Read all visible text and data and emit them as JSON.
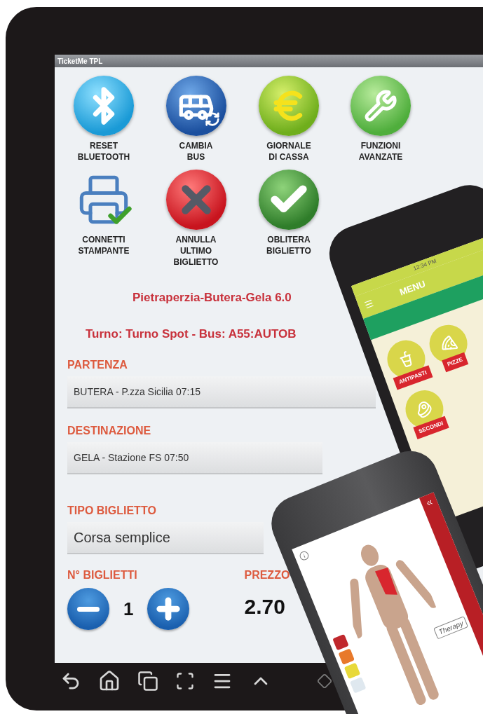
{
  "window": {
    "title": "TicketMe TPL"
  },
  "actions": [
    {
      "kind": "bluetooth",
      "label": "RESET\nBLUETOOTH"
    },
    {
      "kind": "bus",
      "label": "CAMBIA\nBUS"
    },
    {
      "kind": "cash",
      "label": "GIORNALE\nDI CASSA"
    },
    {
      "kind": "tools",
      "label": "FUNZIONI\nAVANZATE"
    },
    {
      "kind": "printer",
      "label": "CONNETTI\nSTAMPANTE"
    },
    {
      "kind": "cancel",
      "label": "ANNULLA\nULTIMO\nBIGLIETTO"
    },
    {
      "kind": "validate",
      "label": "OBLITERA\nBIGLIETTO"
    }
  ],
  "route": "Pietraperzia-Butera-Gela 6.0",
  "shift": "Turno: Turno Spot - Bus: A55:AUTOB",
  "fields": [
    {
      "label": "PARTENZA",
      "value": "BUTERA - P.zza Sicilia 07:15",
      "kind": "small"
    },
    {
      "label": "DESTINAZIONE",
      "value": "GELA - Stazione FS 07:50",
      "kind": "small"
    },
    {
      "label": "TIPO BIGLIETTO",
      "value": "Corsa semplice",
      "kind": "large"
    }
  ],
  "tickets": {
    "label": "N° BIGLIETTI",
    "count": "1"
  },
  "price": {
    "label": "PREZZO",
    "value": "2.70"
  },
  "menu_phone": {
    "time": "12:34 PM",
    "title": "MENU",
    "categories": [
      "ANTIPASTI",
      "PIZZE",
      "SECONDI"
    ]
  },
  "therapy_phone": {
    "badge": "Therapy",
    "swatches": [
      {
        "color": "#c0282d"
      },
      {
        "color": "#e8792b"
      },
      {
        "color": "#e8d93a"
      },
      {
        "color": "#dfe8ef"
      }
    ]
  }
}
